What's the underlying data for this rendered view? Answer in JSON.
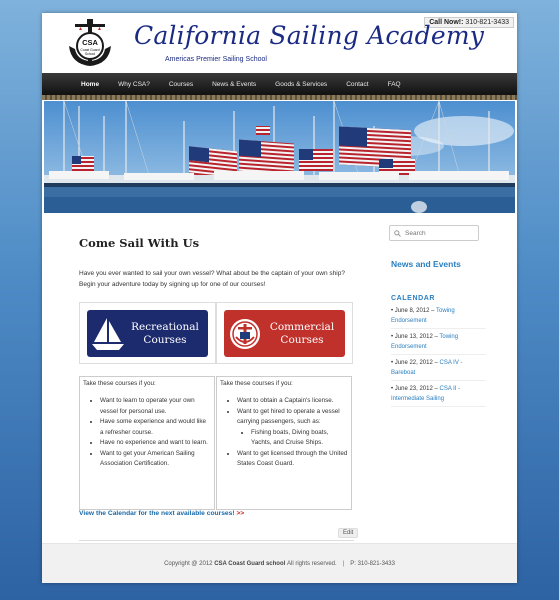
{
  "header": {
    "call_label": "Call Now!:",
    "call_phone": "310-821-3433",
    "logo_text_1": "CSA",
    "logo_text_2": "Coast Guard",
    "logo_text_3": "School",
    "brand": "California Sailing Academy",
    "tagline": "Americas Premier Sailing School"
  },
  "nav": {
    "items": [
      "Home",
      "Why CSA?",
      "Courses",
      "News & Events",
      "Goods & Services",
      "Contact",
      "FAQ"
    ]
  },
  "main": {
    "title": "Come Sail With Us",
    "intro": "Have you ever wanted to sail your own vessel? What about be the captain of your own ship? Begin your adventure today by signing up for one of our courses!",
    "recreational": {
      "line1": "Recreational",
      "line2": "Courses",
      "color": "#1c2a6e"
    },
    "commercial": {
      "line1": "Commercial",
      "line2": "Courses",
      "color": "#c0312c"
    },
    "left_list": {
      "head": "Take these courses if you:",
      "items": [
        "Want to learn to operate your own vessel for personal use.",
        "Have some experience and would like a refresher course.",
        "Have no experience and want to learn.",
        "Want to get your American Sailing Association Certification."
      ]
    },
    "right_list": {
      "head": "Take these courses if you:",
      "items": [
        "Want to obtain a Captain's license.",
        "Want to get hired to operate a vessel carrying passengers, such as:",
        "Want to get licensed through the United States Coast Guard."
      ],
      "sub_items": [
        "Fishing boats, Diving boats, Yachts, and Cruise Ships."
      ]
    },
    "calendar_link": "View the Calendar for the next available courses!",
    "calendar_arrow": ">>",
    "edit_label": "Edit"
  },
  "sidebar": {
    "search_placeholder": "Search",
    "news_link": "News and Events",
    "calendar_heading": "CALENDAR",
    "events": [
      {
        "date": "June 8, 2012 –",
        "title": "Towing Endorsement"
      },
      {
        "date": "June 13, 2012 –",
        "title": "Towing Endorsement"
      },
      {
        "date": "June 22, 2012 –",
        "title": "CSA IV - Bareboat"
      },
      {
        "date": "June 23, 2012 –",
        "title": "CSA II - Intermediate Sailing"
      }
    ]
  },
  "footer": {
    "copyright": "Copyright @ 2012",
    "org": "CSA Coast Guard school",
    "rights": "All rights reserved.",
    "sep": "|",
    "phone": "P: 310-821-3433"
  },
  "colors": {
    "brand_navy": "#1b2b84",
    "link_blue": "#2a7fc0",
    "accent_red": "#c0312c"
  }
}
